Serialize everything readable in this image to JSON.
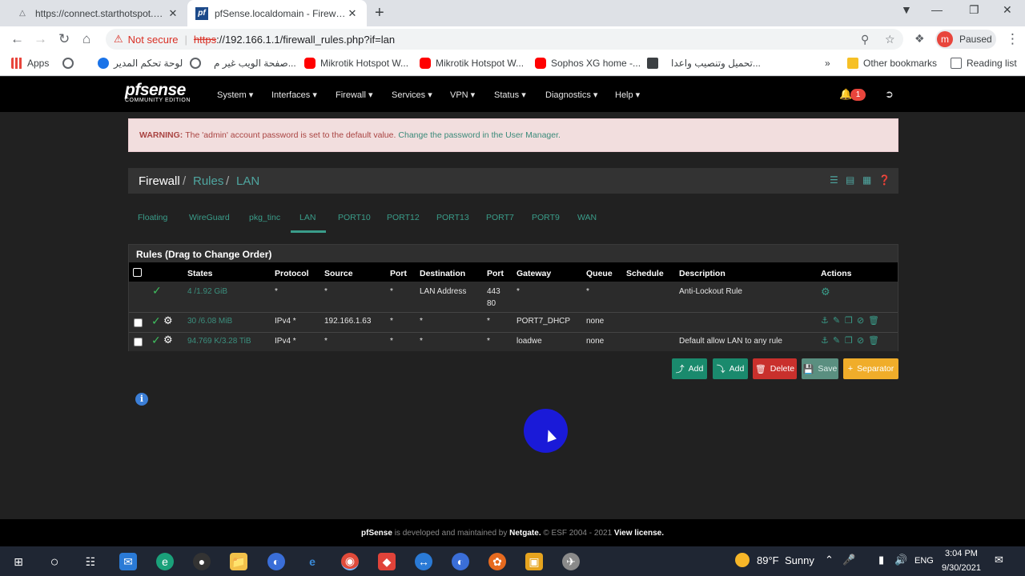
{
  "browser": {
    "tabs": [
      {
        "title": "https://connect.starthotspot.com",
        "active": false
      },
      {
        "title": "pfSense.localdomain - Firewall: R",
        "active": true
      }
    ],
    "security_label": "Not secure",
    "url_scheme": "https",
    "url_rest": "://192.166.1.1/firewall_rules.php?if=lan",
    "profile_initial": "m",
    "profile_status": "Paused",
    "bookmarks": [
      {
        "label": "Apps",
        "icon": "apps-grid-icon"
      },
      {
        "label": "",
        "icon": "globe-icon"
      },
      {
        "label": "لوحة تحكم المدير",
        "icon": "wifi-icon"
      },
      {
        "label": "صفحة الويب غير م...",
        "icon": "globe-icon"
      },
      {
        "label": "Mikrotik Hotspot W...",
        "icon": "youtube-icon"
      },
      {
        "label": "Mikrotik Hotspot W...",
        "icon": "youtube-icon"
      },
      {
        "label": "Sophos XG home -...",
        "icon": "youtube-icon"
      },
      {
        "label": "تحميل وتنصيب واعدا...",
        "icon": "site-icon"
      }
    ],
    "other_bookmarks": "Other bookmarks",
    "reading_list": "Reading list"
  },
  "pfsense": {
    "logo": "pfsense",
    "logo_sub": "COMMUNITY EDITION",
    "menu": [
      "System",
      "Interfaces",
      "Firewall",
      "Services",
      "VPN",
      "Status",
      "Diagnostics",
      "Help"
    ],
    "notification_count": "1",
    "alert": {
      "label": "WARNING:",
      "text": "The 'admin' account password is set to the default value.",
      "link": "Change the password in the User Manager."
    },
    "breadcrumb": [
      "Firewall",
      "Rules",
      "LAN"
    ],
    "interface_tabs": [
      "Floating",
      "WireGuard",
      "pkg_tinc",
      "LAN",
      "PORT10",
      "PORT12",
      "PORT13",
      "PORT7",
      "PORT9",
      "WAN"
    ],
    "active_tab": "LAN",
    "panel_title": "Rules (Drag to Change Order)",
    "columns": [
      "States",
      "Protocol",
      "Source",
      "Port",
      "Destination",
      "Port",
      "Gateway",
      "Queue",
      "Schedule",
      "Description",
      "Actions"
    ],
    "rules": [
      {
        "states": "4 /1.92 GiB",
        "protocol": "*",
        "source": "*",
        "src_port": "*",
        "destination": "LAN Address",
        "dst_port": "443",
        "dst_port2": "80",
        "gateway": "*",
        "queue": "*",
        "schedule": "",
        "description": "Anti-Lockout Rule"
      },
      {
        "states": "30 /6.08 MiB",
        "protocol": "IPv4 *",
        "source": "192.166.1.63",
        "src_port": "*",
        "destination": "*",
        "dst_port": "*",
        "gateway": "PORT7_DHCP",
        "queue": "none",
        "schedule": "",
        "description": ""
      },
      {
        "states": "94.769 K/3.28 TiB",
        "protocol": "IPv4 *",
        "source": "*",
        "src_port": "*",
        "destination": "*",
        "dst_port": "*",
        "gateway": "loadwe",
        "queue": "none",
        "schedule": "",
        "description": "Default allow LAN to any rule"
      }
    ],
    "buttons": {
      "add_top": "Add",
      "add_bottom": "Add",
      "delete": "Delete",
      "save": "Save",
      "separator": "Separator"
    },
    "footer": {
      "brand": "pfSense",
      "middle": " is developed and maintained by ",
      "company": "Netgate.",
      "copy": " © ESF 2004 - 2021 ",
      "license": "View license."
    }
  },
  "taskbar": {
    "weather_temp": "89°F",
    "weather_desc": "Sunny",
    "lang": "ENG",
    "time": "3:04 PM",
    "date": "9/30/2021"
  },
  "colors": {
    "accent": "#3a9d8a",
    "danger": "#c9302c",
    "warning": "#f0ad2a",
    "nav_bg": "#000000",
    "page_bg": "#212121"
  }
}
